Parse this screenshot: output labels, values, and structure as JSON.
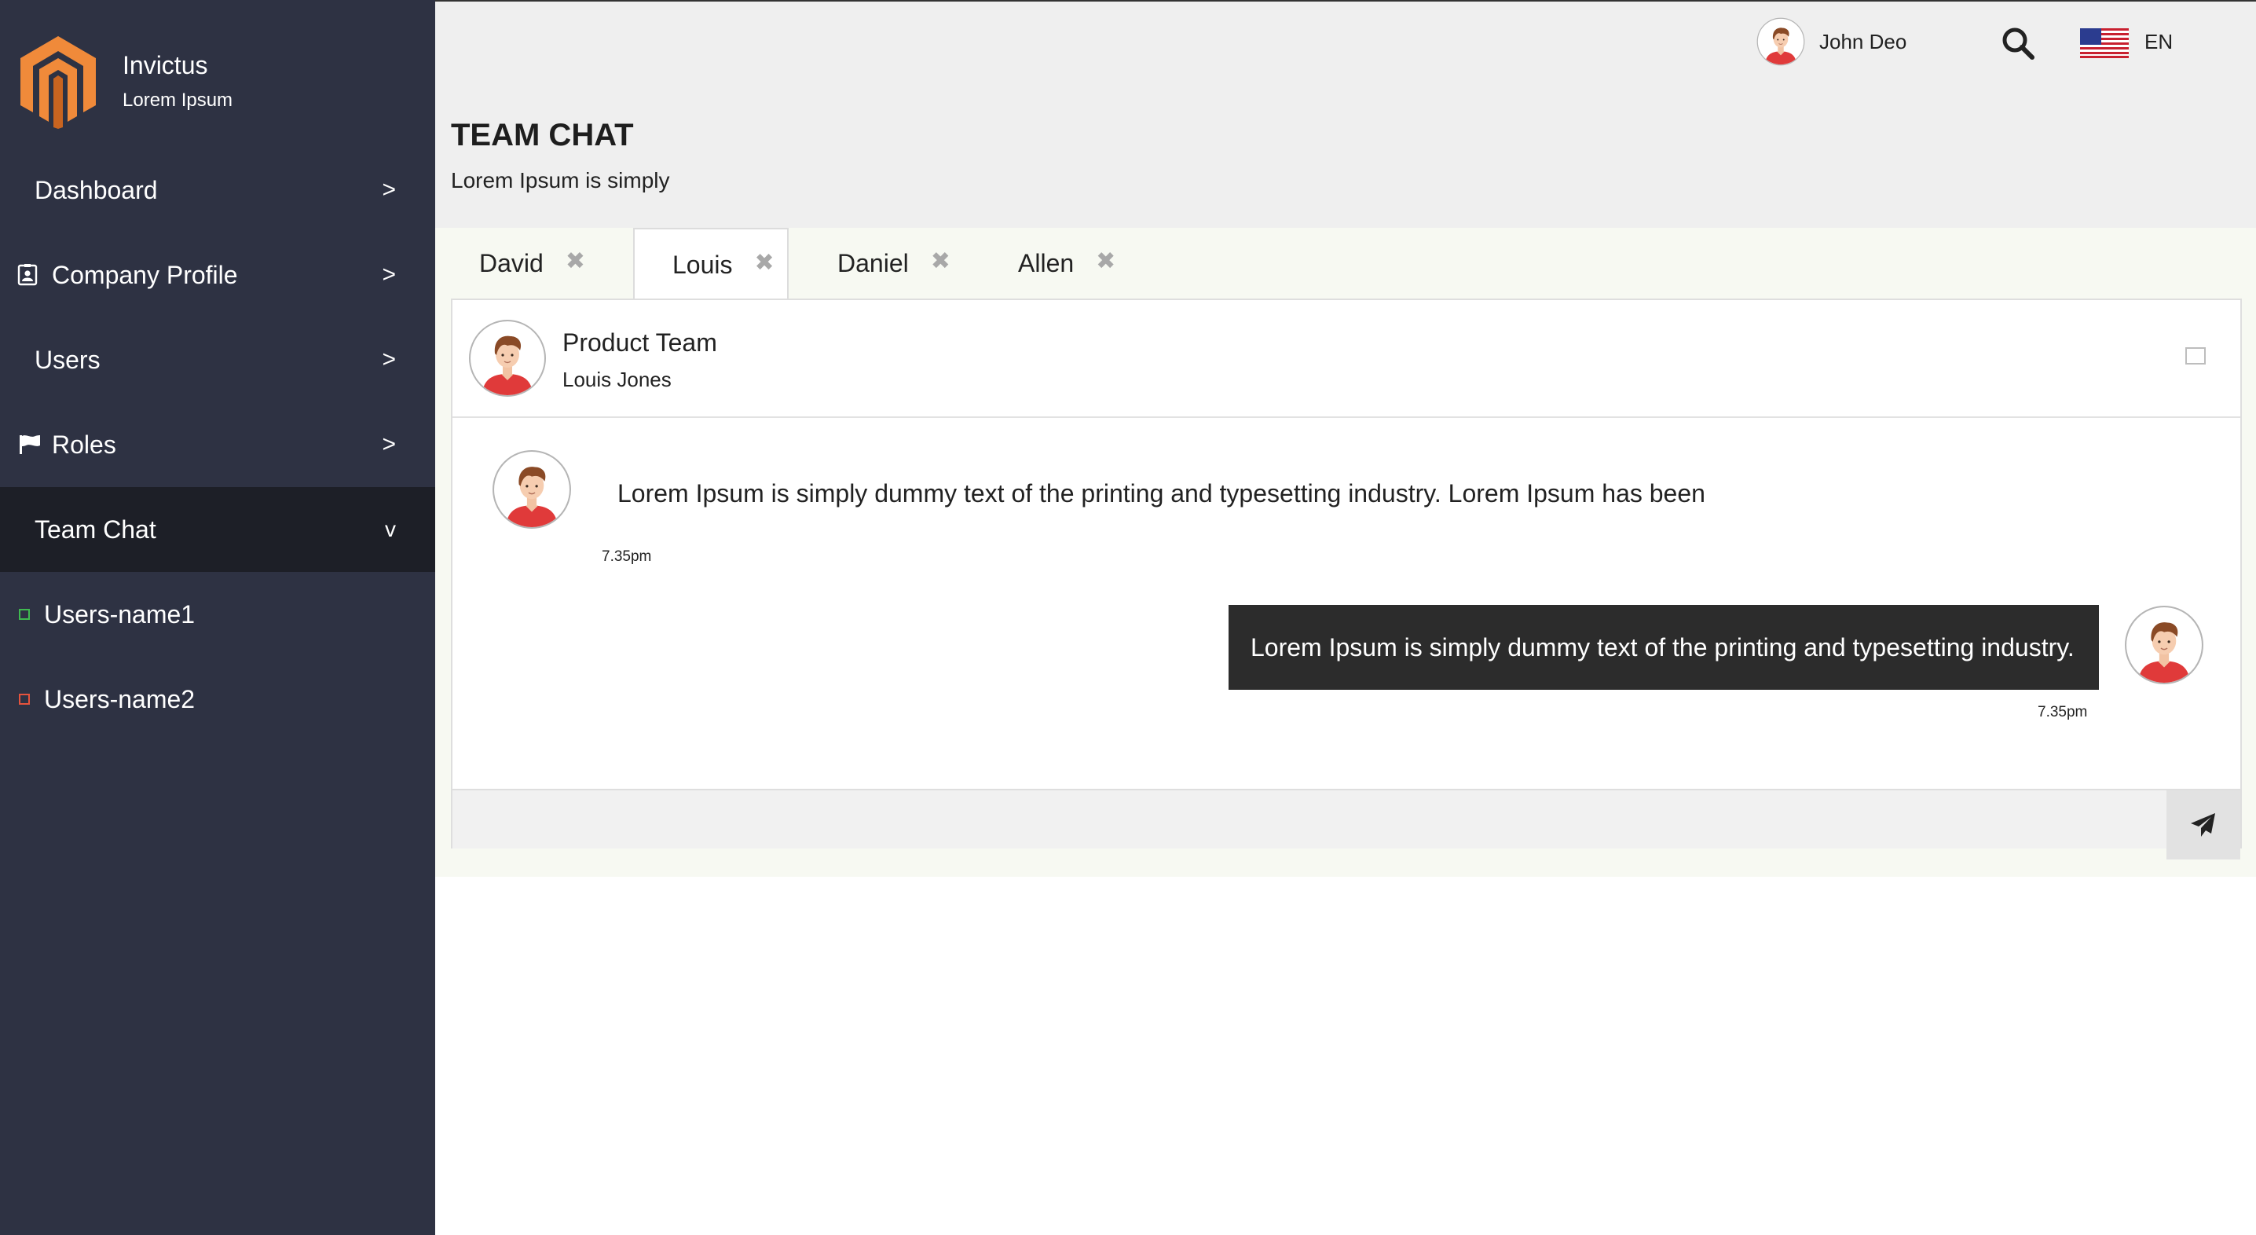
{
  "brand": {
    "name": "Invictus",
    "subtitle": "Lorem Ipsum"
  },
  "sidebar": {
    "items": [
      {
        "label": "Dashboard",
        "chevron": ">"
      },
      {
        "label": "Company Profile",
        "chevron": ">",
        "icon": "id-badge-icon"
      },
      {
        "label": "Users",
        "chevron": ">"
      },
      {
        "label": "Roles",
        "chevron": ">",
        "icon": "flag-icon"
      },
      {
        "label": "Team Chat",
        "chevron": "v",
        "active": true
      }
    ],
    "subitems": [
      {
        "label": "Users-name1",
        "status_color": "#3fb950"
      },
      {
        "label": "Users-name2",
        "status_color": "#e5533d"
      }
    ]
  },
  "header": {
    "user_name": "John Deo",
    "language": "EN",
    "title": "TEAM CHAT",
    "subtitle": "Lorem Ipsum is simply"
  },
  "tabs": [
    {
      "label": "David",
      "close": "✖"
    },
    {
      "label": "Louis",
      "close": "✖",
      "active": true
    },
    {
      "label": "Daniel",
      "close": "✖"
    },
    {
      "label": "Allen",
      "close": "✖"
    }
  ],
  "chat": {
    "group_name": "Product Team",
    "member_name": "Louis Jones",
    "messages": [
      {
        "direction": "incoming",
        "text": "Lorem Ipsum is simply dummy text of the printing and typesetting industry. Lorem Ipsum has been",
        "time": "7.35pm"
      },
      {
        "direction": "outgoing",
        "text": "Lorem Ipsum is simply dummy text of the printing and typesetting industry.",
        "time": "7.35pm"
      }
    ],
    "composer_value": ""
  },
  "colors": {
    "sidebar_bg": "#2e3243",
    "sidebar_active": "#1d1f27",
    "logo_orange": "#f08a3a",
    "outgoing_bubble": "#2c2c2c",
    "avatar_shirt": "#e03a3a"
  }
}
